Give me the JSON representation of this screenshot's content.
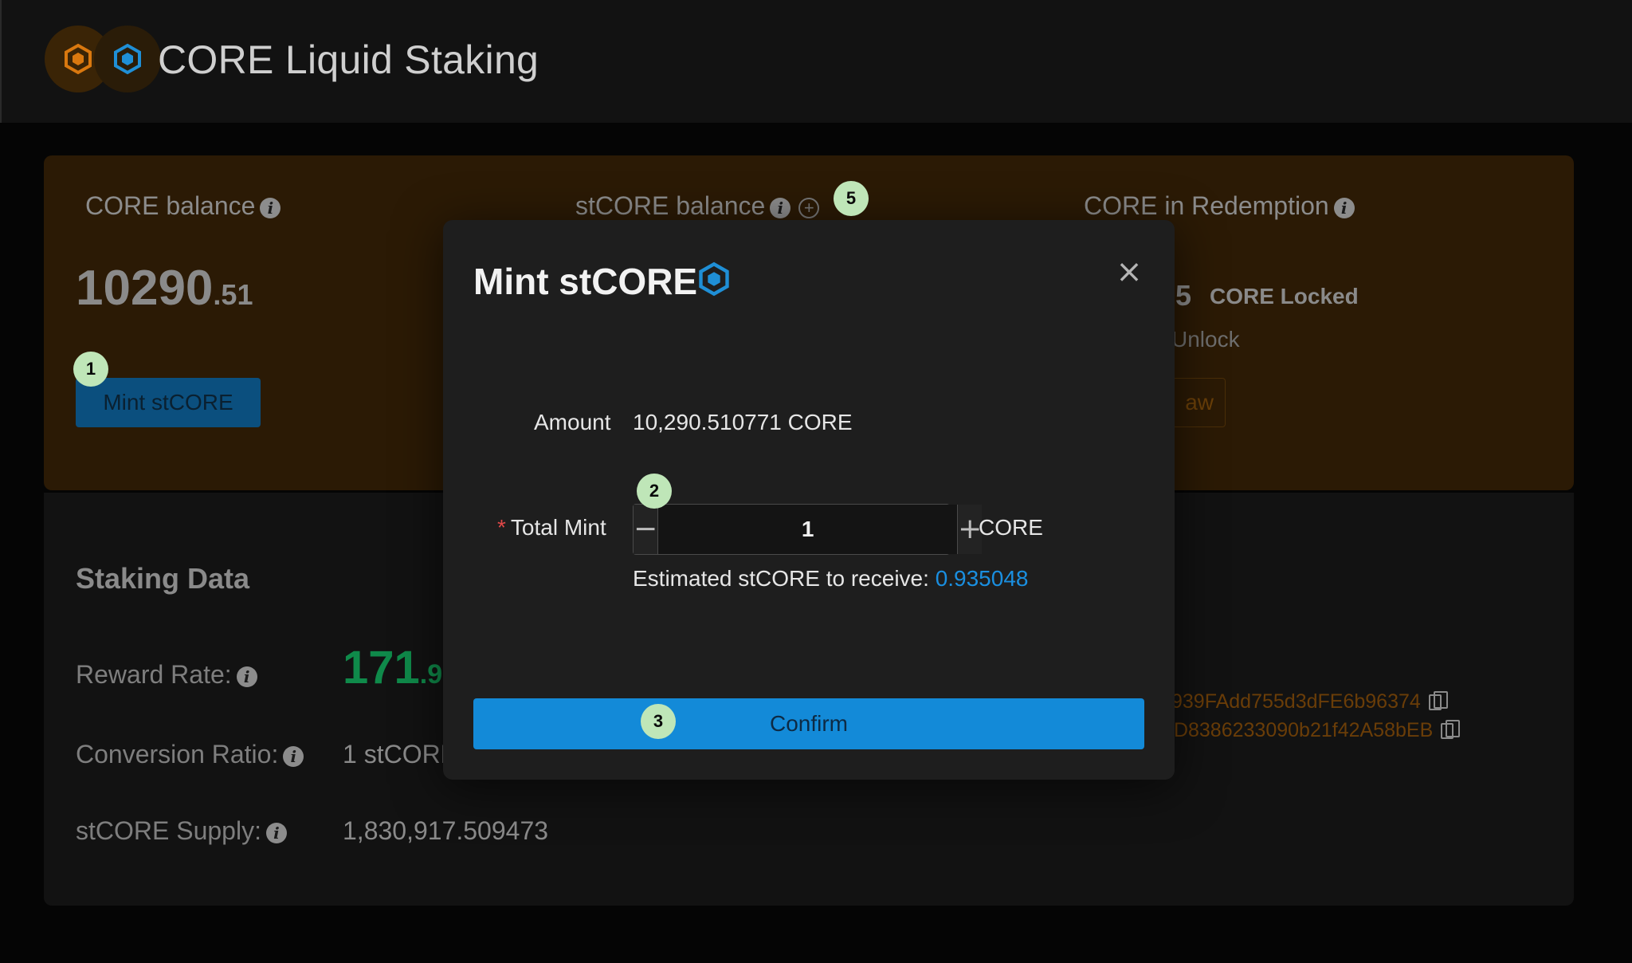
{
  "header": {
    "title": "CORE Liquid Staking"
  },
  "balances": {
    "core_balance_label": "CORE balance",
    "core_balance_int": "10290",
    "core_balance_dec": ".51",
    "stcore_balance_label": "stCORE balance",
    "redemption_label": "CORE in Redemption",
    "locked_value": "5",
    "locked_label": "CORE Locked",
    "unlock_label": "Unlock",
    "mint_button": "Mint stCORE",
    "withdraw_button": "aw"
  },
  "staking": {
    "title": "Staking Data",
    "reward_rate_label": "Reward Rate:",
    "reward_rate_int": "171",
    "reward_rate_dec": ".9",
    "conversion_label": "Conversion Ratio:",
    "conversion_value": "1 stCORE",
    "supply_label": "stCORE Supply:",
    "supply_value": "1,830,917.509473",
    "address_1": "939FAdd755d3dFE6b96374",
    "address_2": ":D8386233090b21f42A58bEB"
  },
  "modal": {
    "title": "Mint stCORE",
    "close": "×",
    "amount_label": "Amount",
    "amount_value": "10,290.510771  CORE",
    "total_mint_label": "Total Mint",
    "required_mark": "*",
    "minus": "−",
    "plus": "+",
    "mint_value": "1",
    "unit": "CORE",
    "estimate_label": "Estimated stCORE to receive: ",
    "estimate_value": "0.935048",
    "confirm_button": "Confirm"
  },
  "markers": [
    "1",
    "2",
    "3",
    "5"
  ],
  "colors": {
    "accent_blue": "#138ad8",
    "reward_green": "#0f8a4a",
    "address_orange": "#6a3d08",
    "marker_green": "#bfe6b8"
  },
  "icons": {
    "logo_a": "core-hexagon-orange-icon",
    "logo_b": "core-hexagon-blue-icon",
    "info": "info-icon",
    "add": "plus-circle-icon",
    "copy": "copy-icon",
    "close": "close-icon"
  }
}
